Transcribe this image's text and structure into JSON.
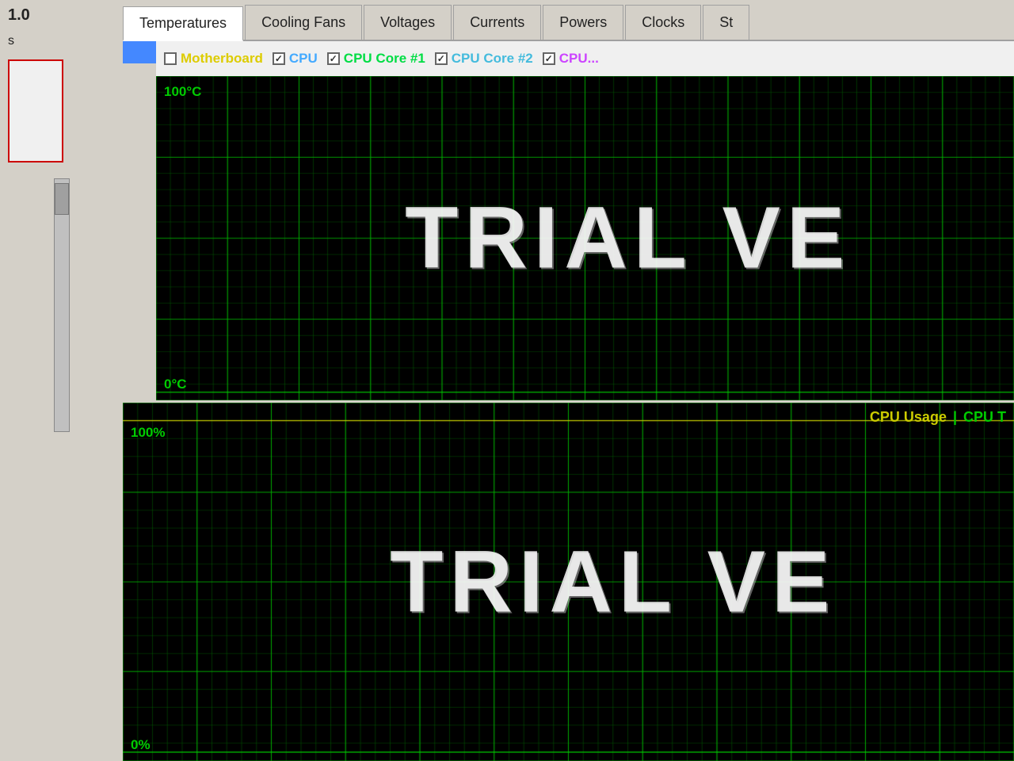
{
  "sidebar": {
    "version": "1.0",
    "label": "s",
    "redBox": true
  },
  "tabs": [
    {
      "label": "Temperatures",
      "active": true
    },
    {
      "label": "Cooling Fans",
      "active": false
    },
    {
      "label": "Voltages",
      "active": false
    },
    {
      "label": "Currents",
      "active": false
    },
    {
      "label": "Powers",
      "active": false
    },
    {
      "label": "Clocks",
      "active": false
    },
    {
      "label": "St",
      "active": false
    }
  ],
  "chart1": {
    "legend": [
      {
        "label": "Motherboard",
        "color": "#ddcc00",
        "checked": false
      },
      {
        "label": "CPU",
        "color": "#44aaff",
        "checked": true
      },
      {
        "label": "CPU Core #1",
        "color": "#00dd44",
        "checked": true
      },
      {
        "label": "CPU Core #2",
        "color": "#44bbdd",
        "checked": true
      },
      {
        "label": "CPU...",
        "color": "#cc44ff",
        "checked": true
      }
    ],
    "maxLabel": "100°C",
    "minLabel": "0°C",
    "watermark": "TRIAL VE"
  },
  "chart2": {
    "legend": [
      {
        "label": "CPU Usage",
        "color": "#cccc00"
      },
      {
        "label": "|",
        "color": "#00cc00"
      },
      {
        "label": "CPU T",
        "color": "#00cc00"
      }
    ],
    "maxLabel": "100%",
    "minLabel": "0%",
    "watermark": "TRIAL VE"
  },
  "colors": {
    "gridGreen": "#00aa00",
    "gridBright": "#00cc00",
    "motherboard": "#ddcc00",
    "cpu": "#44aaff",
    "cpuCore1": "#00dd44",
    "cpuCore2": "#44bbdd",
    "cpuUsage": "#cccc00",
    "cpuT": "#00cc00"
  }
}
